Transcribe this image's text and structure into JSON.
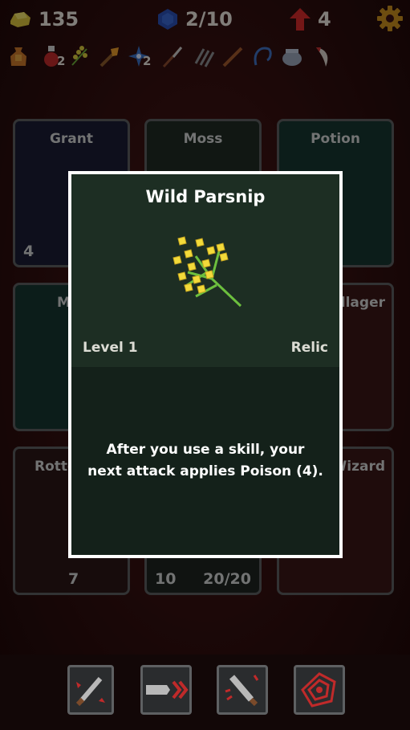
{
  "topbar": {
    "gold": "135",
    "gems": "2/10",
    "level": "4"
  },
  "relics": [
    {
      "icon": "pouch-icon",
      "count": ""
    },
    {
      "icon": "potion-icon",
      "count": "2"
    },
    {
      "icon": "herb-icon",
      "count": ""
    },
    {
      "icon": "torch-icon",
      "count": ""
    },
    {
      "icon": "star-icon",
      "count": "2"
    },
    {
      "icon": "blade-icon",
      "count": ""
    },
    {
      "icon": "claw-icon",
      "count": ""
    },
    {
      "icon": "sword-icon",
      "count": ""
    },
    {
      "icon": "hook-icon",
      "count": ""
    },
    {
      "icon": "cauldron-icon",
      "count": ""
    },
    {
      "icon": "fang-icon",
      "count": ""
    }
  ],
  "cards": [
    {
      "name": "Grant",
      "left_num": "4",
      "right_num": ""
    },
    {
      "name": "Moss",
      "left_num": "",
      "right_num": ""
    },
    {
      "name": "Potion",
      "left_num": "",
      "right_num": ""
    },
    {
      "name": "Ma",
      "left_num": "",
      "right_num": ""
    },
    {
      "name": "",
      "left_num": "",
      "right_num": ""
    },
    {
      "name": "Villager",
      "left_num": "",
      "right_num": ""
    },
    {
      "name": "Rotte",
      "left_num": "7",
      "right_num": ""
    },
    {
      "name": "",
      "left_num": "10",
      "right_num": "20/20"
    },
    {
      "name": "g Wizard",
      "left_num": "",
      "right_num": ""
    }
  ],
  "modal": {
    "title": "Wild Parsnip",
    "level": "Level 1",
    "kind": "Relic",
    "description": "After you use a skill, your next attack applies Poison (4)."
  },
  "skills": [
    {
      "icon": "dagger-skill-icon"
    },
    {
      "icon": "dash-skill-icon"
    },
    {
      "icon": "strike-skill-icon"
    },
    {
      "icon": "vortex-skill-icon"
    }
  ]
}
